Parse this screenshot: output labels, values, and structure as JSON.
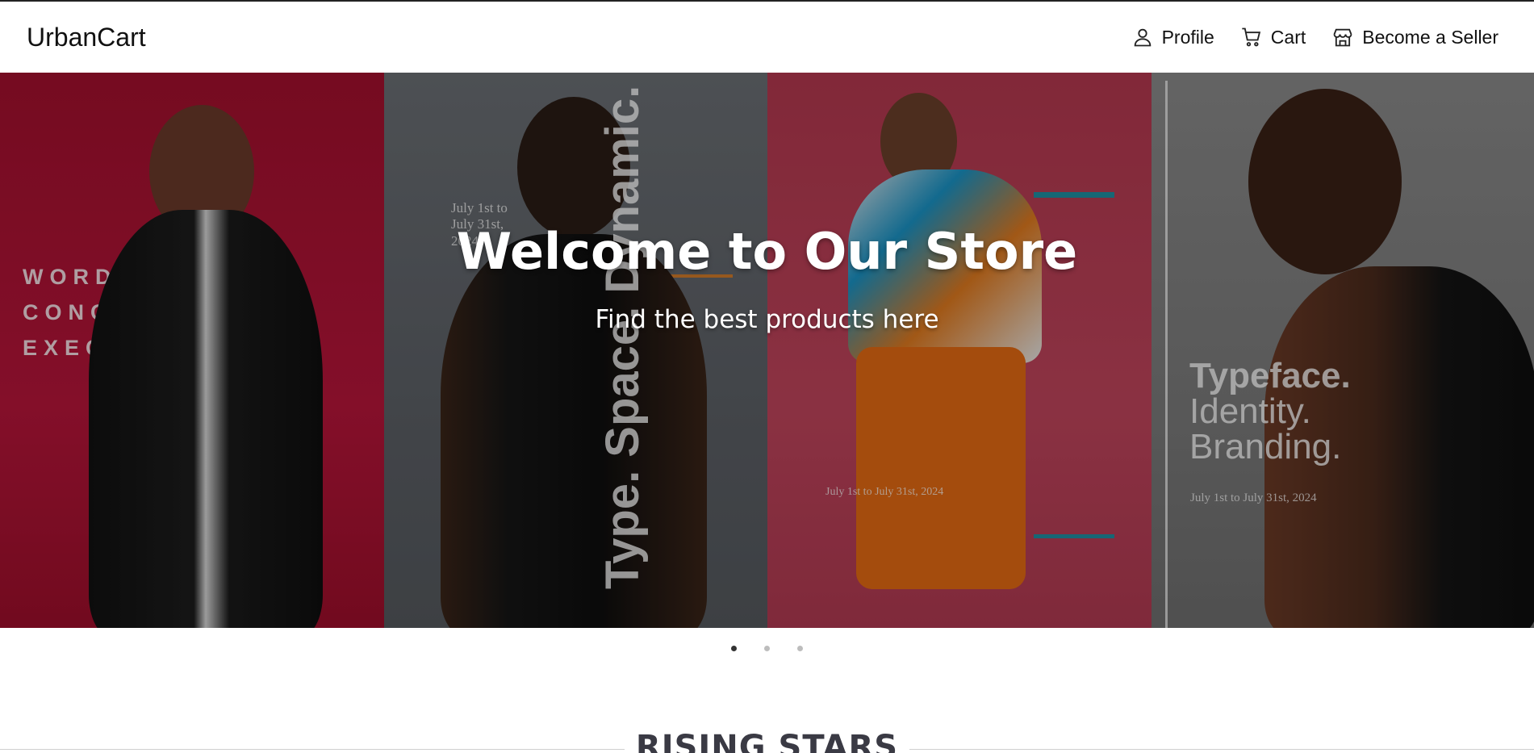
{
  "header": {
    "brand": "UrbanCart",
    "nav": [
      {
        "label": "Profile",
        "icon": "user-icon"
      },
      {
        "label": "Cart",
        "icon": "cart-icon"
      },
      {
        "label": "Become a Seller",
        "icon": "store-icon"
      }
    ]
  },
  "hero": {
    "title": "Welcome to Our Store",
    "subtitle": "Find the best products here",
    "posters": {
      "p1_lines": [
        "WORDPLAY.",
        "CONCEPT.",
        "EXECUTION."
      ],
      "p2_dates": "July 1st to\nJuly 31st,\n2024",
      "p2_vertical": "Type. Space. Dynamic.",
      "p3_dates": "July 1st to July 31st, 2024",
      "p4_big": [
        "Typeface.",
        "Identity.",
        "Branding."
      ],
      "p4_dates": "July 1st to July 31st, 2024"
    }
  },
  "carousel": {
    "dots": 3,
    "active_index": 0
  },
  "section": {
    "title": "RISING STARS"
  },
  "colors": {
    "accent_teal": "#1f8fa3",
    "accent_orange": "#e08a2a",
    "dot_active": "#333333",
    "dot_inactive": "#bdbdbd"
  }
}
